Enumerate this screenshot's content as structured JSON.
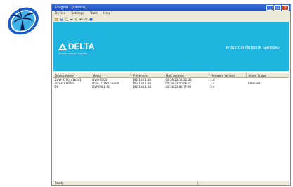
{
  "desktop_icon": {
    "name": "delta-configuration-icon",
    "colors": {
      "outer": "#1a5cc8",
      "inner": "#3fb2ea",
      "figure": "#0a1f55"
    }
  },
  "window": {
    "title": "DSignal - [Device]",
    "controls": {
      "minimize_label": "_",
      "maximize_label": "□",
      "close_label": "×"
    },
    "menu": [
      "Device",
      "Settings",
      "Tools",
      "Help"
    ],
    "toolbar_icons": [
      "open-icon",
      "save-icon",
      "search-icon",
      "print-icon",
      "refresh-icon",
      "connect-icon",
      "settings-icon",
      "info-icon"
    ]
  },
  "banner": {
    "background": "#1fb5df",
    "logo_text": "DELTA",
    "logo_tagline": "Smarter. Greener. Together.",
    "title": "Industrial Network Gateway"
  },
  "table": {
    "columns": [
      "Device Name",
      "Model",
      "IP Address",
      "MAC Address",
      "Firmware Version",
      "Alarm Status"
    ],
    "rows": [
      [
        "DVW-S100_a1b2c3",
        "DVW-S100",
        "192.168.1.10",
        "00:18:23:11:22:33",
        "1.0",
        ""
      ],
      [
        "DVS-B109DUI",
        "DVS-110W02-3SFP",
        "192.168.1.20",
        "00:18:23:55:6E:7F",
        "2.4",
        "Ethernet"
      ],
      [
        "DS",
        "DVPEN01-SL",
        "192.168.1.30",
        "00:18:23:8E:7F:90",
        "2.4",
        ""
      ]
    ]
  },
  "statusbar": {
    "text": "Ready"
  }
}
